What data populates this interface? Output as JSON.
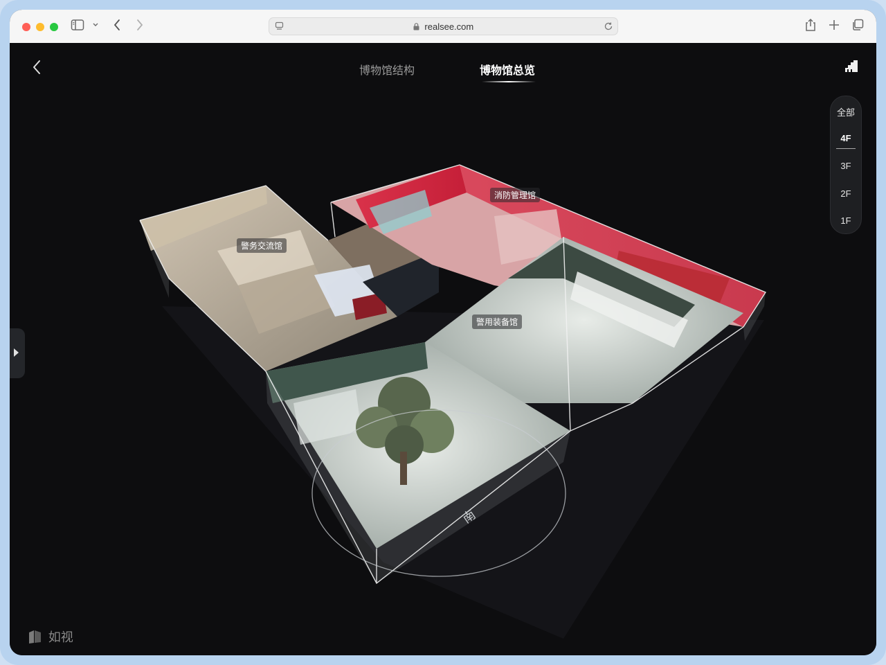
{
  "browser": {
    "url": "realsee.com",
    "colors": {
      "close": "#ff5f57",
      "minimize": "#febc2e",
      "zoom": "#28c840"
    }
  },
  "nav": {
    "back_icon": "chevron-left-icon",
    "tabs": [
      {
        "label": "博物馆结构",
        "active": false
      },
      {
        "label": "博物馆总览",
        "active": true
      }
    ]
  },
  "floors": {
    "items": [
      "全部",
      "4F",
      "3F",
      "2F",
      "1F"
    ],
    "selected": "4F"
  },
  "rooms": {
    "police_exchange": "警务交流馆",
    "fire_management": "消防管理馆",
    "police_equipment": "警用装备馆"
  },
  "compass": {
    "south_label": "南"
  },
  "brand": {
    "logo_text": "如视"
  }
}
